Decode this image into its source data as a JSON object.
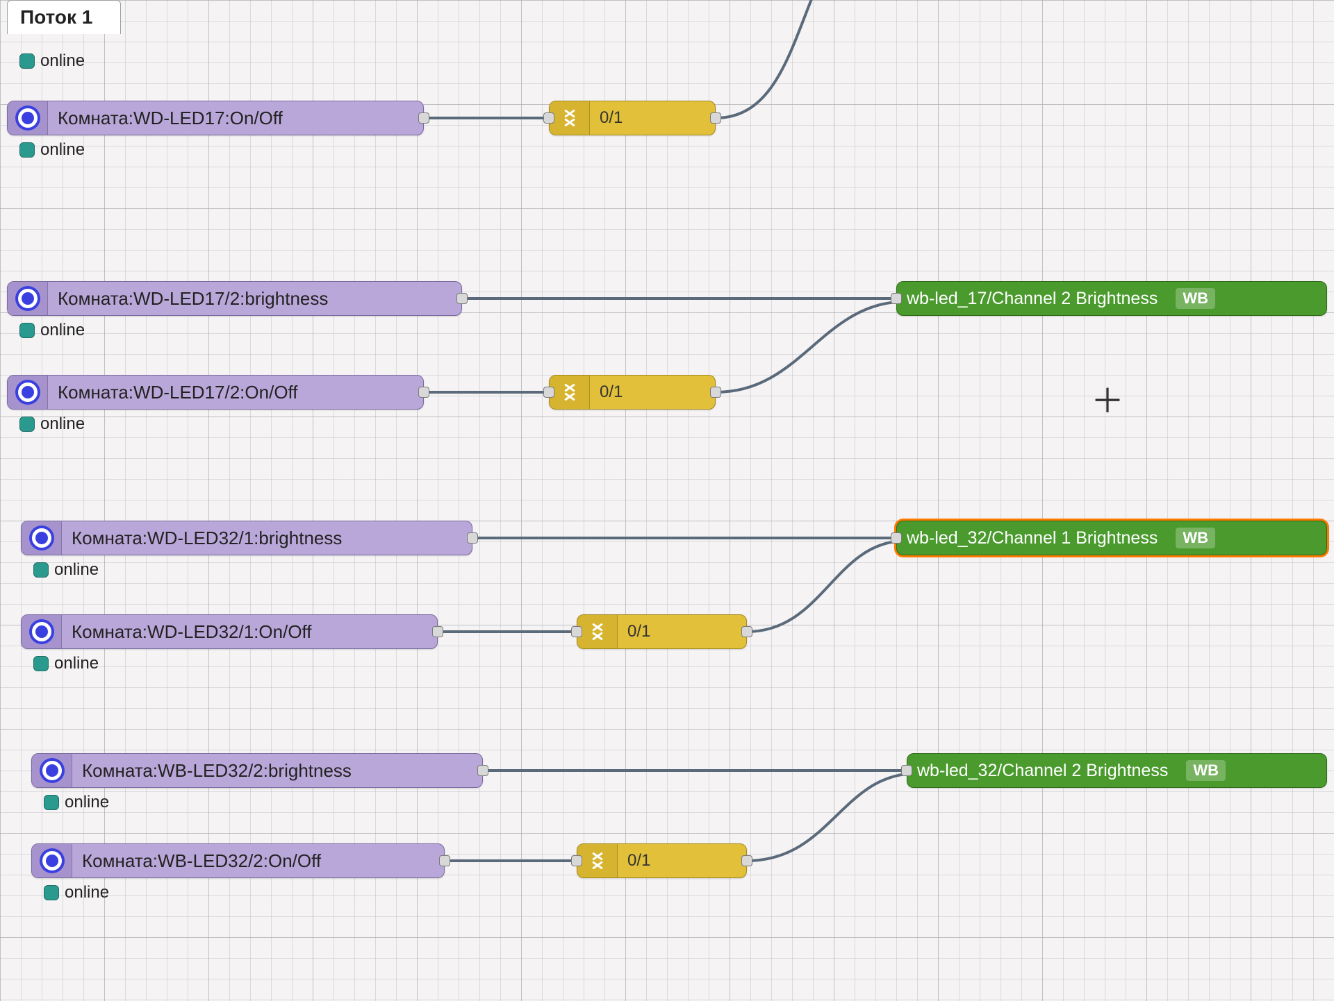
{
  "tab": {
    "title": "Поток 1"
  },
  "status_text": "online",
  "plus_glyph": "＋",
  "nodes": {
    "n0_status": "online",
    "n1": {
      "label": "Комната:WD-LED17:On/Off",
      "status": "online"
    },
    "s1": {
      "label": "0/1"
    },
    "n2": {
      "label": "Комната:WD-LED17/2:brightness",
      "status": "online"
    },
    "g2": {
      "label": "wb-led_17/Channel 2 Brightness",
      "badge": "WB"
    },
    "n3": {
      "label": "Комната:WD-LED17/2:On/Off",
      "status": "online"
    },
    "s3": {
      "label": "0/1"
    },
    "n4": {
      "label": "Комната:WD-LED32/1:brightness",
      "status": "online"
    },
    "g4": {
      "label": "wb-led_32/Channel 1 Brightness",
      "badge": "WB"
    },
    "n5": {
      "label": "Комната:WD-LED32/1:On/Off",
      "status": "online"
    },
    "s5": {
      "label": "0/1"
    },
    "n6": {
      "label": "Комната:WB-LED32/2:brightness",
      "status": "online"
    },
    "g6": {
      "label": "wb-led_32/Channel 2 Brightness",
      "badge": "WB"
    },
    "n7": {
      "label": "Комната:WB-LED32/2:On/Off",
      "status": "online"
    },
    "s7": {
      "label": "0/1"
    }
  }
}
